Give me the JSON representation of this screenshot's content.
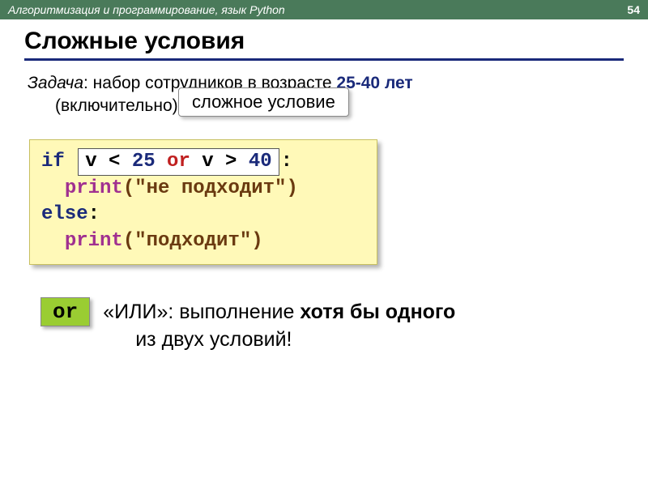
{
  "header": {
    "course": "Алгоритмизация и программирование, язык Python",
    "page": "54"
  },
  "title": "Сложные условия",
  "task": {
    "label": "Задача",
    "text1": ": набор сотрудников в возрасте ",
    "range": "25-40 лет",
    "text2": "(включительно).",
    "badge": "сложное условие"
  },
  "code": {
    "if": "if",
    "cond_v1": "v < ",
    "cond_n1": "25",
    "cond_or": " or ",
    "cond_v2": "v > ",
    "cond_n2": "40",
    "colon": ":",
    "print1_fn": "print",
    "print1_arg": "(\"не подходит\")",
    "else": "else",
    "print2_fn": "print",
    "print2_arg": "(\"подходит\")"
  },
  "or_block": {
    "badge": "or",
    "pre": "«ИЛИ»: выполнение ",
    "bold": "хотя бы одного",
    "line2": "из двух условий!"
  }
}
